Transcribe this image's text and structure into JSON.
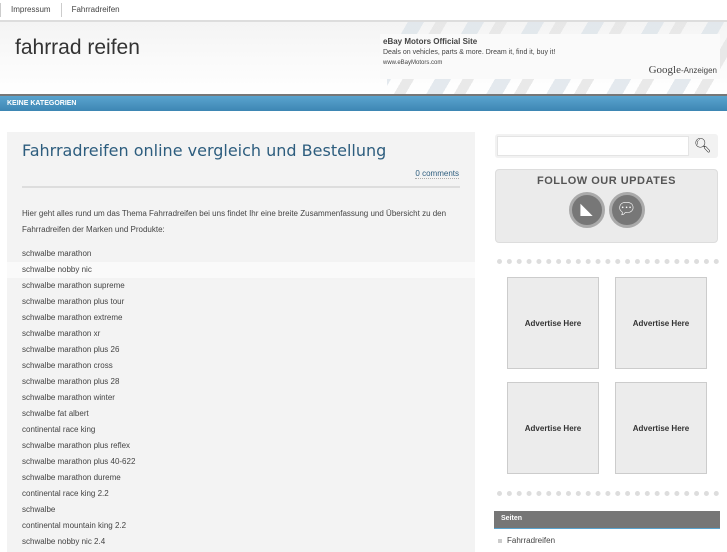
{
  "topnav": [
    "Impressum",
    "Fahrradreifen"
  ],
  "site_title": "fahrrad reifen",
  "ad": {
    "title": "eBay Motors Official Site",
    "text": "Deals on vehicles, parts & more. Dream it, find it, buy it!",
    "url": "www.eBayMotors.com",
    "google": "Google",
    "anzeigen": "-Anzeigen"
  },
  "category_bar": "KEINE KATEGORIEN",
  "post": {
    "title": "Fahrradreifen online vergleich und Bestellung",
    "comments": "0 comments",
    "intro": "Hier geht alles rund um das Thema Fahrradreifen bei uns findet Ihr eine breite Zusammenfassung und Übersicht zu den Fahrradreifen der Marken und Produkte:",
    "items": [
      "schwalbe marathon",
      "schwalbe nobby nic",
      "schwalbe marathon supreme",
      "schwalbe marathon plus tour",
      "schwalbe marathon extreme",
      "schwalbe marathon xr",
      "schwalbe marathon plus 26",
      "schwalbe marathon cross",
      "schwalbe marathon plus 28",
      "schwalbe marathon winter",
      "schwalbe fat albert",
      "continental race king",
      "schwalbe marathon plus reflex",
      "schwalbe marathon plus 40-622",
      "schwalbe marathon dureme",
      "continental race king 2.2",
      "schwalbe",
      "continental mountain king 2.2",
      "schwalbe nobby nic 2.4"
    ]
  },
  "sidebar": {
    "follow_title": "FOLLOW OUR UPDATES",
    "ads": [
      "Advertise Here",
      "Advertise Here",
      "Advertise Here",
      "Advertise Here"
    ],
    "widget_title": "Seiten",
    "pages": [
      "Fahrradreifen"
    ]
  }
}
